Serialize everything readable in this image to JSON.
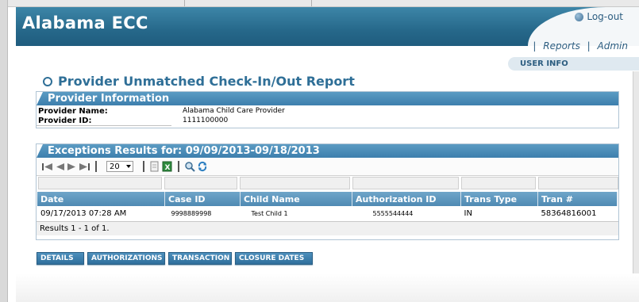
{
  "app": {
    "title": "Alabama ECC",
    "logout_label": "Log-out"
  },
  "top_links": {
    "reports": "Reports",
    "admin": "Admin",
    "separator": "|"
  },
  "user_info_tab": "USER INFO",
  "page_title": "Provider Unmatched Check-In/Out Report",
  "provider_section": {
    "heading": "Provider Information",
    "name_label": "Provider Name:",
    "name_value": "Alabama Child Care Provider",
    "id_label": "Provider ID:",
    "id_value": "1111100000"
  },
  "exceptions_section": {
    "heading": "Exceptions Results for: 09/09/2013-09/18/2013",
    "page_size": "20",
    "columns": [
      "Date",
      "Case ID",
      "Child Name",
      "Authorization ID",
      "Trans Type",
      "Tran #"
    ],
    "rows": [
      {
        "date": "09/17/2013 07:28 AM",
        "case_id": "9998889998",
        "child_name": "Test Child 1",
        "authorization_id": "5555544444",
        "trans_type": "IN",
        "tran_no": "58364816001"
      }
    ],
    "results_text": "Results 1 - 1 of 1."
  },
  "action_buttons": {
    "details": "DETAILS",
    "authorizations": "AUTHORIZATIONS",
    "transaction": "TRANSACTION",
    "closure_dates": "CLOSURE DATES"
  },
  "colors": {
    "banner": "#26688a",
    "header_blue": "#3d7fad",
    "link": "#2c5d80"
  }
}
